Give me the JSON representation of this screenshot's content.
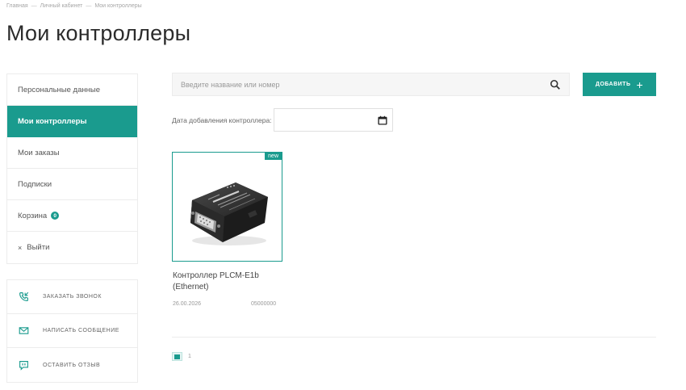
{
  "breadcrumb": {
    "items": [
      "Главная",
      "Личный кабинет",
      "Мои контроллеры"
    ],
    "separator": "—"
  },
  "page_title": "Мои контроллеры",
  "sidebar": {
    "items": [
      {
        "label": "Персональные данные",
        "active": false
      },
      {
        "label": "Мои контроллеры",
        "active": true
      },
      {
        "label": "Мои заказы",
        "active": false
      },
      {
        "label": "Подписки",
        "active": false
      },
      {
        "label": "Корзина",
        "badge": "0",
        "active": false
      },
      {
        "label": "Выйти",
        "icon": "close-icon",
        "active": false
      }
    ]
  },
  "contacts": [
    {
      "label": "ЗАКАЗАТЬ ЗВОНОК",
      "icon": "phone-callback-icon"
    },
    {
      "label": "НАПИСАТЬ СООБЩЕНИЕ",
      "icon": "mail-icon"
    },
    {
      "label": "ОСТАВИТЬ ОТЗЫВ",
      "icon": "review-icon"
    }
  ],
  "search": {
    "placeholder": "Введите название или номер",
    "value": "",
    "icon": "search-icon"
  },
  "add_button": {
    "label": "ДОБАВИТЬ",
    "icon": "plus-icon"
  },
  "date_filter": {
    "label": "Дата добавления контроллера:",
    "value": "",
    "icon": "calendar-icon"
  },
  "products": [
    {
      "badge": "new",
      "name": "Контроллер PLCM-E1b (Ethernet)",
      "date": "26.00.2026",
      "number": "05000000"
    }
  ],
  "pagination": {
    "current": "1"
  },
  "colors": {
    "accent": "#1a9b8e",
    "text": "#2b2b2b",
    "muted": "#999999",
    "border": "#ececec"
  }
}
